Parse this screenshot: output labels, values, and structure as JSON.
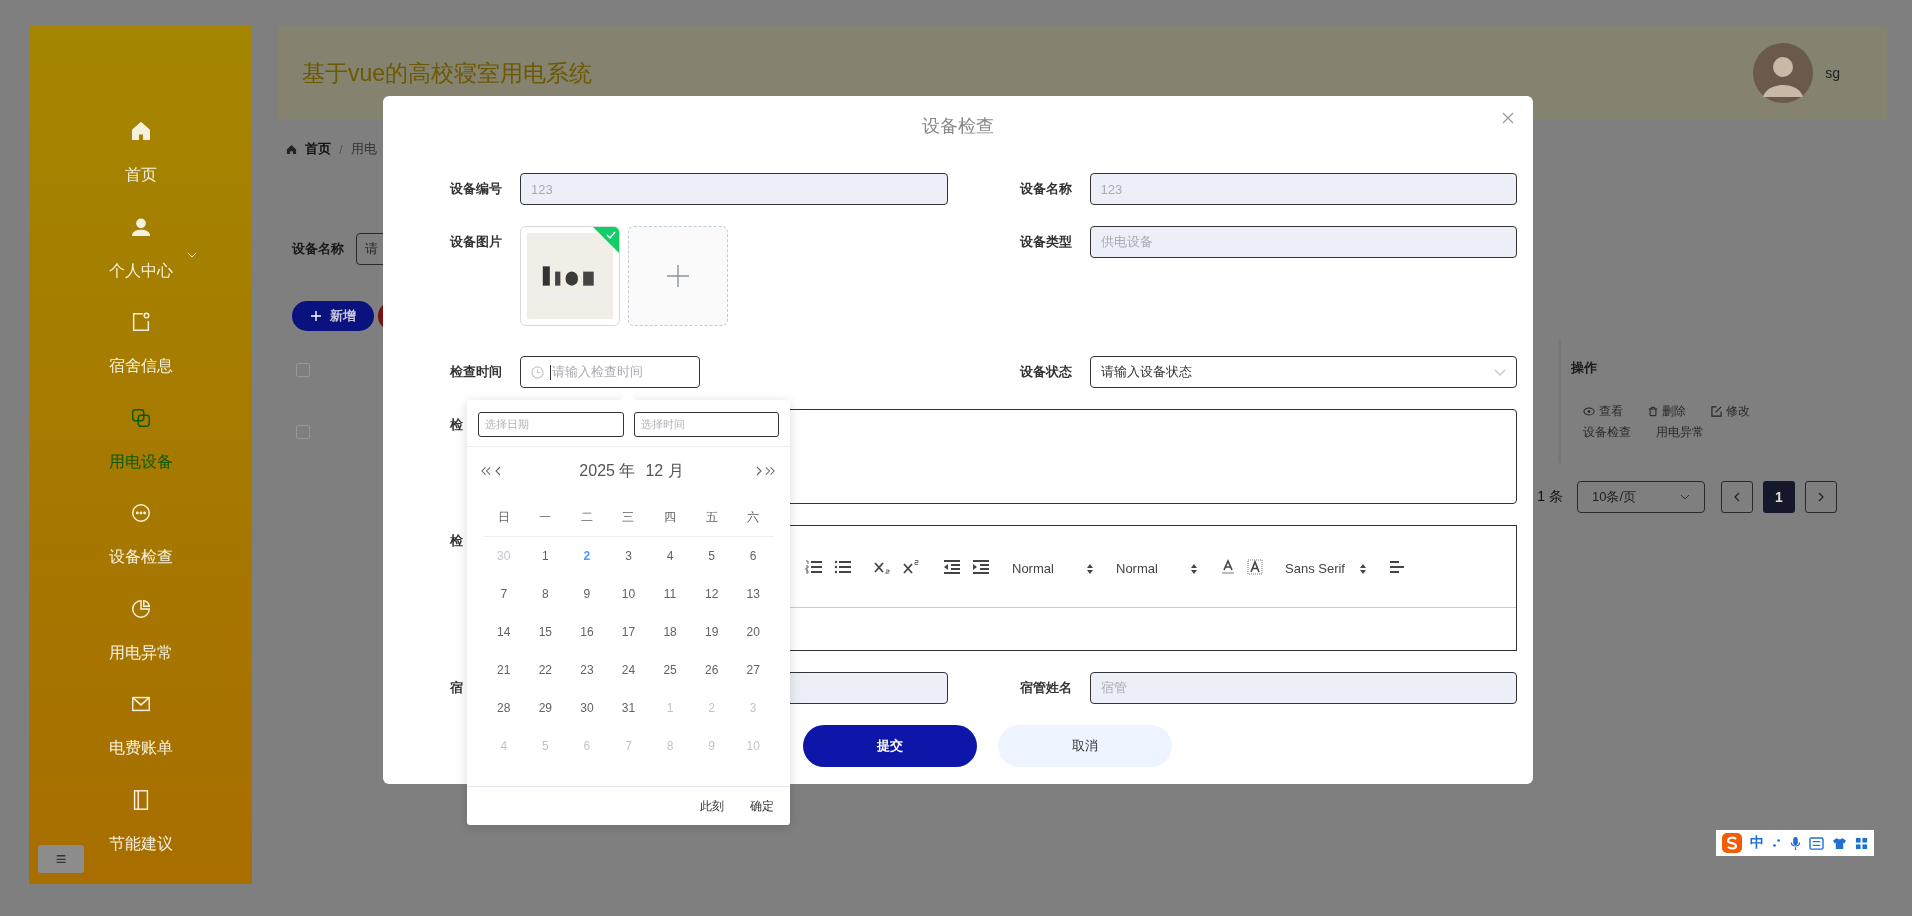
{
  "sidebar": {
    "items": [
      {
        "label": "首页",
        "selected": false,
        "has_children": false
      },
      {
        "label": "个人中心",
        "selected": false,
        "has_children": true
      },
      {
        "label": "宿舍信息",
        "selected": false,
        "has_children": false
      },
      {
        "label": "用电设备",
        "selected": true,
        "has_children": false
      },
      {
        "label": "设备检查",
        "selected": false,
        "has_children": false
      },
      {
        "label": "用电异常",
        "selected": false,
        "has_children": false
      },
      {
        "label": "电费账单",
        "selected": false,
        "has_children": false
      },
      {
        "label": "节能建议",
        "selected": false,
        "has_children": false
      }
    ],
    "toggle": "≡"
  },
  "header": {
    "title": "基于vue的高校寝室用电系统",
    "user": "sg"
  },
  "breadcrumb": {
    "items": [
      "首页",
      "用电"
    ],
    "separator": "/"
  },
  "search": {
    "label": "设备名称",
    "placeholder": "请"
  },
  "toolbar": {
    "buttons": [
      {
        "label": "新增",
        "kind": "primary"
      },
      {
        "kind": "danger"
      }
    ]
  },
  "table": {
    "checkboxes": [
      {
        "checked": false
      },
      {
        "checked": false
      }
    ],
    "actions_header": "操作",
    "actions": [
      {
        "label": "查看"
      },
      {
        "label": "删除"
      },
      {
        "label": "修改"
      },
      {
        "label": "设备检查"
      },
      {
        "label": "用电异常"
      }
    ]
  },
  "pagination": {
    "total": "1 条",
    "page_size": "10条/页",
    "pages": [
      {
        "label": "1",
        "selected": true
      }
    ]
  },
  "dialog": {
    "title": "设备检查",
    "fields": [
      {
        "kind": "input",
        "label": "设备编号",
        "value": "123",
        "disabled": true
      },
      {
        "kind": "input",
        "label": "设备名称",
        "value": "123",
        "disabled": true
      },
      {
        "kind": "upload",
        "label": "设备图片",
        "uploaded": true
      },
      {
        "kind": "input",
        "label": "设备类型",
        "value": "供电设备",
        "disabled": true
      },
      {
        "kind": "date",
        "label": "检查时间",
        "placeholder": "请输入检查时间"
      },
      {
        "kind": "select",
        "label": "设备状态",
        "value": "请输入设备状态"
      },
      {
        "kind": "textarea",
        "label": "检"
      },
      {
        "kind": "editor",
        "label": "检"
      },
      {
        "kind": "input",
        "label": "宿",
        "disabled": true
      },
      {
        "kind": "input",
        "label": "宿管姓名",
        "placeholder": "宿管",
        "disabled": true
      }
    ],
    "editor_toolbar": [
      {
        "items": [
          {
            "kind": "ordered-list"
          },
          {
            "kind": "bullet-list"
          }
        ]
      },
      {
        "items": [
          {
            "kind": "subscript"
          },
          {
            "kind": "superscript"
          }
        ]
      },
      {
        "items": [
          {
            "kind": "outdent"
          },
          {
            "kind": "indent"
          }
        ]
      },
      {
        "items": [
          {
            "kind": "select",
            "label": "Normal"
          }
        ]
      },
      {
        "items": [
          {
            "kind": "select",
            "label": "Normal"
          }
        ]
      },
      {
        "items": [
          {
            "kind": "color"
          },
          {
            "kind": "background"
          }
        ]
      },
      {
        "items": [
          {
            "kind": "select",
            "label": "Sans Serif"
          }
        ]
      },
      {
        "items": [
          {
            "kind": "align"
          }
        ]
      }
    ],
    "buttons": [
      {
        "label": "提交",
        "kind": "primary"
      },
      {
        "label": "取消",
        "kind": "default"
      }
    ]
  },
  "date_picker": {
    "date_placeholder": "选择日期",
    "time_placeholder": "选择时间",
    "year": "2025 年",
    "month": "12 月",
    "weekdays": [
      "日",
      "一",
      "二",
      "三",
      "四",
      "五",
      "六"
    ],
    "days": [
      {
        "label": "30",
        "in_month": false,
        "today": false
      },
      {
        "label": "1",
        "in_month": true,
        "today": false
      },
      {
        "label": "2",
        "in_month": true,
        "today": true
      },
      {
        "label": "3",
        "in_month": true,
        "today": false
      },
      {
        "label": "4",
        "in_month": true,
        "today": false
      },
      {
        "label": "5",
        "in_month": true,
        "today": false
      },
      {
        "label": "6",
        "in_month": true,
        "today": false
      },
      {
        "label": "7",
        "in_month": true,
        "today": false
      },
      {
        "label": "8",
        "in_month": true,
        "today": false
      },
      {
        "label": "9",
        "in_month": true,
        "today": false
      },
      {
        "label": "10",
        "in_month": true,
        "today": false
      },
      {
        "label": "11",
        "in_month": true,
        "today": false
      },
      {
        "label": "12",
        "in_month": true,
        "today": false
      },
      {
        "label": "13",
        "in_month": true,
        "today": false
      },
      {
        "label": "14",
        "in_month": true,
        "today": false
      },
      {
        "label": "15",
        "in_month": true,
        "today": false
      },
      {
        "label": "16",
        "in_month": true,
        "today": false
      },
      {
        "label": "17",
        "in_month": true,
        "today": false
      },
      {
        "label": "18",
        "in_month": true,
        "today": false
      },
      {
        "label": "19",
        "in_month": true,
        "today": false
      },
      {
        "label": "20",
        "in_month": true,
        "today": false
      },
      {
        "label": "21",
        "in_month": true,
        "today": false
      },
      {
        "label": "22",
        "in_month": true,
        "today": false
      },
      {
        "label": "23",
        "in_month": true,
        "today": false
      },
      {
        "label": "24",
        "in_month": true,
        "today": false
      },
      {
        "label": "25",
        "in_month": true,
        "today": false
      },
      {
        "label": "26",
        "in_month": true,
        "today": false
      },
      {
        "label": "27",
        "in_month": true,
        "today": false
      },
      {
        "label": "28",
        "in_month": true,
        "today": false
      },
      {
        "label": "29",
        "in_month": true,
        "today": false
      },
      {
        "label": "30",
        "in_month": true,
        "today": false
      },
      {
        "label": "31",
        "in_month": true,
        "today": false
      },
      {
        "label": "1",
        "in_month": false,
        "today": false
      },
      {
        "label": "2",
        "in_month": false,
        "today": false
      },
      {
        "label": "3",
        "in_month": false,
        "today": false
      },
      {
        "label": "4",
        "in_month": false,
        "today": false
      },
      {
        "label": "5",
        "in_month": false,
        "today": false
      },
      {
        "label": "6",
        "in_month": false,
        "today": false
      },
      {
        "label": "7",
        "in_month": false,
        "today": false
      },
      {
        "label": "8",
        "in_month": false,
        "today": false
      },
      {
        "label": "9",
        "in_month": false,
        "today": false
      },
      {
        "label": "10",
        "in_month": false,
        "today": false
      }
    ],
    "footer": [
      "此刻",
      "确定"
    ]
  },
  "ime": {
    "label": "中"
  }
}
